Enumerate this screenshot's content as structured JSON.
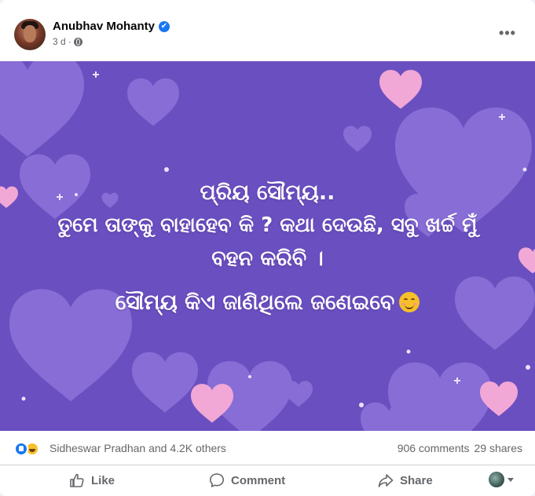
{
  "post": {
    "author": "Anubhav Mohanty",
    "verified_badge": "✔",
    "time": "3 d",
    "time_separator": "·",
    "privacy_icon": "globe-icon",
    "more_label": "•••"
  },
  "image_text": {
    "line1": "ପ୍ରିୟ ସୌମ୍ୟ..",
    "line2": "ତୁମେ ତାଙ୍କୁ ବାହାହେବ କି ? କଥା ଦେଉଛି, ସବୁ ଖର୍ଚ୍ଚ ମୁଁ",
    "line3": "ବହନ କରିବି ।",
    "line4": "ସୌମ୍ୟ କିଏ ଜାଣିଥିଲେ ଜଣେଇବେ"
  },
  "stats": {
    "reactors": "Sidheswar Pradhan and 4.2K others",
    "comments": "906 comments",
    "shares": "29 shares"
  },
  "actions": {
    "like": "Like",
    "comment": "Comment",
    "share": "Share"
  },
  "colors": {
    "background_purple": "#6a4fc0",
    "heart_lavender": "#8a6fd6",
    "heart_pink": "#f2a8d6",
    "link_blue": "#1877f2",
    "secondary_text": "#65676b"
  }
}
